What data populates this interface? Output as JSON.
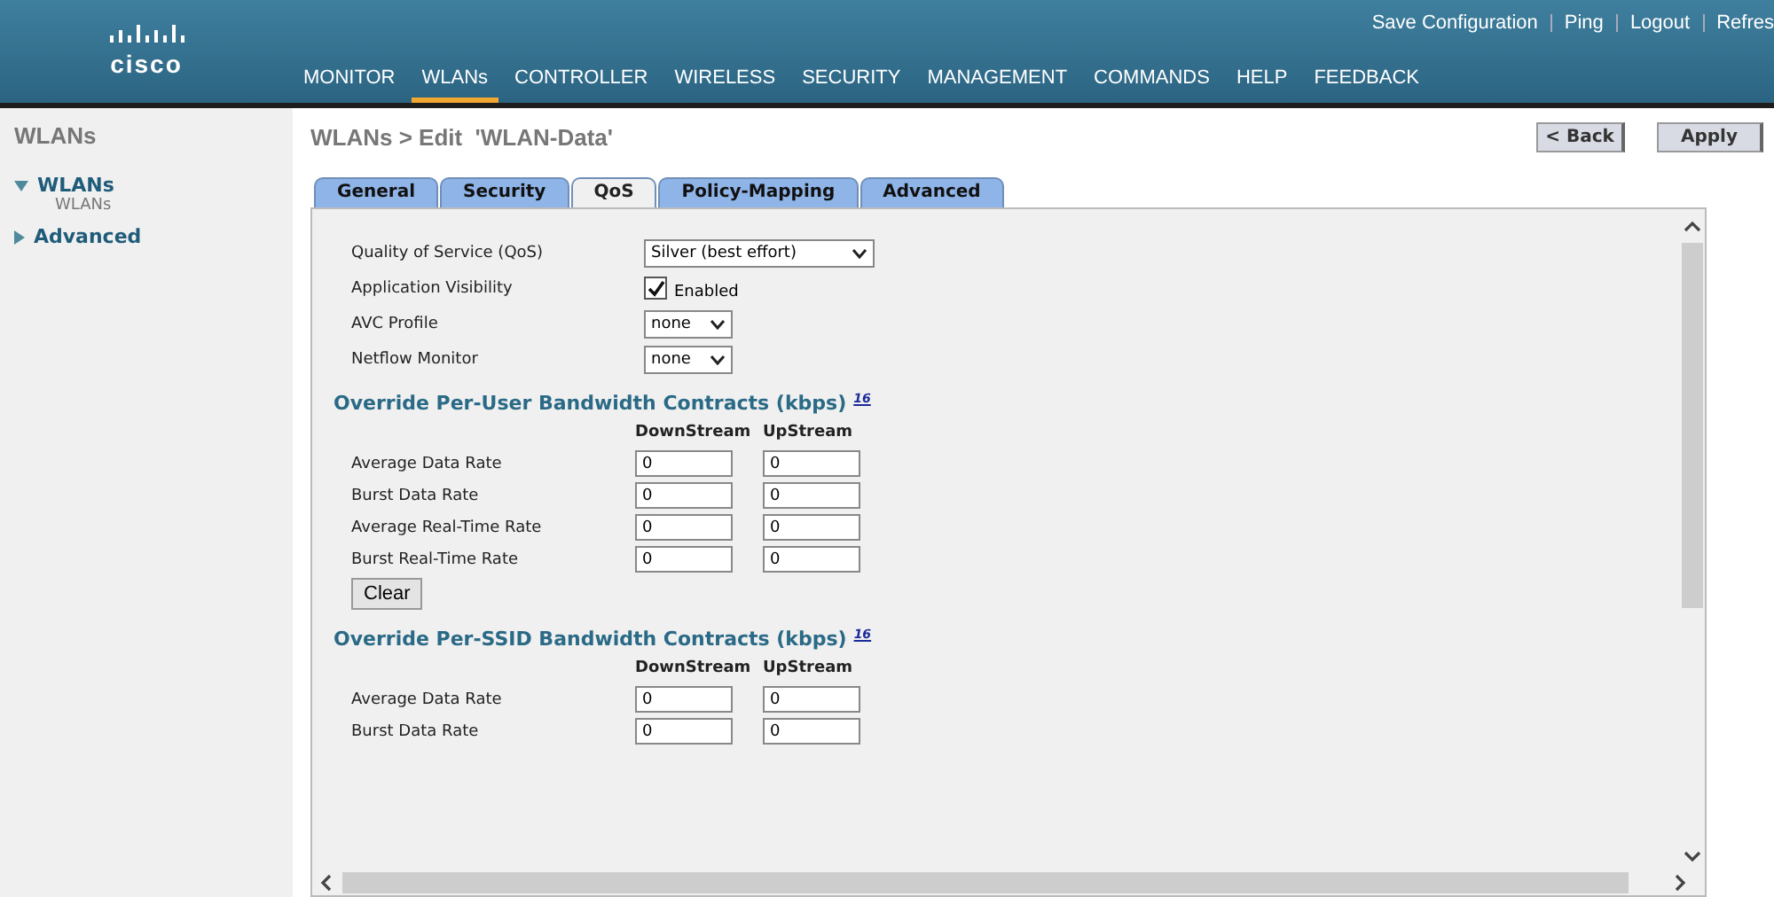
{
  "header": {
    "logo": "cisco",
    "top_links": [
      "Save Configuration",
      "Ping",
      "Logout",
      "Refres"
    ],
    "nav": [
      {
        "label": "MONITOR",
        "selected": false
      },
      {
        "label": "WLANs",
        "selected": true
      },
      {
        "label": "CONTROLLER",
        "selected": false
      },
      {
        "label": "WIRELESS",
        "selected": false
      },
      {
        "label": "SECURITY",
        "selected": false
      },
      {
        "label": "MANAGEMENT",
        "selected": false
      },
      {
        "label": "COMMANDS",
        "selected": false
      },
      {
        "label": "HELP",
        "selected": false
      },
      {
        "label": "FEEDBACK",
        "selected": false
      }
    ]
  },
  "sidebar": {
    "title": "WLANs",
    "items": [
      {
        "label": "WLANs",
        "expanded": true,
        "children": [
          {
            "label": "WLANs"
          }
        ]
      },
      {
        "label": "Advanced",
        "expanded": false
      }
    ]
  },
  "page": {
    "title": "WLANs > Edit  'WLAN-Data'",
    "buttons": [
      "< Back",
      "Apply"
    ]
  },
  "tabs": [
    {
      "label": "General",
      "selected": false
    },
    {
      "label": "Security",
      "selected": false
    },
    {
      "label": "QoS",
      "selected": true
    },
    {
      "label": "Policy-Mapping",
      "selected": false
    },
    {
      "label": "Advanced",
      "selected": false
    }
  ],
  "settings": [
    {
      "kind": "select",
      "label": "Quality of Service (QoS)",
      "value": "Silver (best effort)"
    },
    {
      "kind": "checkbox",
      "label": "Application Visibility",
      "text": "Enabled",
      "checked": true
    },
    {
      "kind": "select",
      "label": "AVC Profile",
      "value": "none"
    },
    {
      "kind": "select",
      "label": "Netflow Monitor",
      "value": "none"
    }
  ],
  "sections": [
    {
      "title": "Override Per-User Bandwidth Contracts (kbps)",
      "note": "16",
      "columns": [
        "DownStream",
        "UpStream"
      ],
      "rows": [
        {
          "label": "Average Data Rate",
          "values": [
            "0",
            "0"
          ]
        },
        {
          "label": "Burst Data Rate",
          "values": [
            "0",
            "0"
          ]
        },
        {
          "label": "Average Real-Time Rate",
          "values": [
            "0",
            "0"
          ]
        },
        {
          "label": "Burst Real-Time Rate",
          "values": [
            "0",
            "0"
          ]
        }
      ],
      "button": "Clear"
    },
    {
      "title": "Override Per-SSID Bandwidth Contracts (kbps)",
      "note": "16",
      "columns": [
        "DownStream",
        "UpStream"
      ],
      "rows": [
        {
          "label": "Average Data Rate",
          "values": [
            "0",
            "0"
          ]
        },
        {
          "label": "Burst Data Rate",
          "values": [
            "0",
            "0"
          ]
        }
      ]
    }
  ]
}
